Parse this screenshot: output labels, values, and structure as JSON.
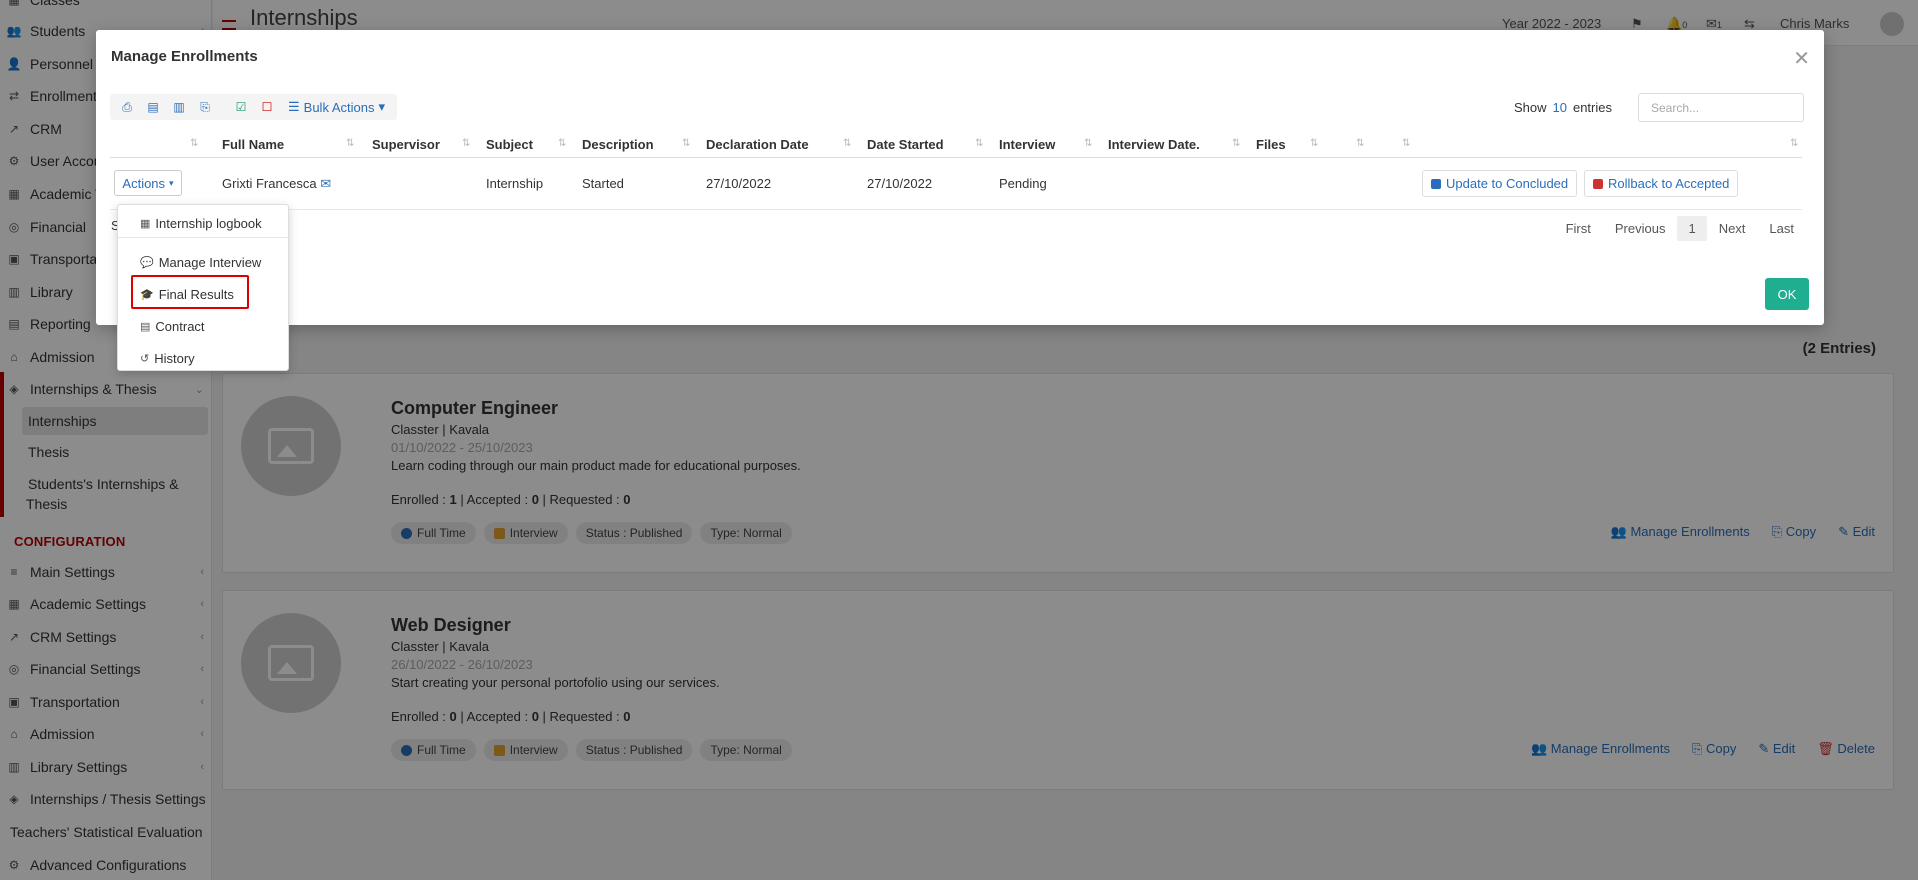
{
  "app": {
    "page_title": "Internships",
    "year_selector": "Year 2022 - 2023",
    "user_name": "Chris Marks",
    "notifications_count": "0",
    "messages_count": "1"
  },
  "sidebar": {
    "items": [
      {
        "label": "Classes",
        "icon": "grid-icon"
      },
      {
        "label": "Students",
        "icon": "users-icon"
      },
      {
        "label": "Personnel",
        "icon": "user-icon"
      },
      {
        "label": "Enrollment",
        "icon": "swap-icon"
      },
      {
        "label": "CRM",
        "icon": "chart-icon"
      },
      {
        "label": "User Accou",
        "icon": "user-cog-icon"
      },
      {
        "label": "Academic T",
        "icon": "grid-icon"
      },
      {
        "label": "Financial",
        "icon": "coins-icon"
      },
      {
        "label": "Transporta",
        "icon": "bus-icon"
      },
      {
        "label": "Library",
        "icon": "books-icon"
      },
      {
        "label": "Reporting",
        "icon": "file-icon"
      },
      {
        "label": "Admission",
        "icon": "bank-icon"
      },
      {
        "label": "Internships & Thesis",
        "icon": "cube-icon"
      }
    ],
    "sub_items": [
      "Internships",
      "Thesis",
      "Students's Internships &",
      "Thesis"
    ],
    "config_header": "CONFIGURATION",
    "config_items": [
      {
        "label": "Main Settings",
        "icon": "sliders-icon"
      },
      {
        "label": "Academic Settings",
        "icon": "grid-icon"
      },
      {
        "label": "CRM Settings",
        "icon": "chart-icon"
      },
      {
        "label": "Financial Settings",
        "icon": "coins-icon"
      },
      {
        "label": "Transportation",
        "icon": "bus-icon"
      },
      {
        "label": "Admission",
        "icon": "bank-icon"
      },
      {
        "label": "Library Settings",
        "icon": "books-icon"
      },
      {
        "label": "Internships / Thesis Settings",
        "icon": "cube-icon"
      },
      {
        "label": "Teachers' Statistical Evaluation",
        "icon": ""
      },
      {
        "label": "Advanced Configurations",
        "icon": "gear-icon"
      }
    ]
  },
  "content": {
    "entries_count": "(2 Entries)",
    "cards": [
      {
        "title": "Computer Engineer",
        "subtitle": "Classter | Kavala",
        "dates": "01/10/2022 - 25/10/2023",
        "description": "Learn coding through our main product made for educational purposes.",
        "counts_label_enrolled": "Enrolled : ",
        "enrolled": "1",
        "counts_label_accepted": " | Accepted : ",
        "accepted": "0",
        "counts_label_requested": " | Requested : ",
        "requested": "0",
        "tags": [
          "Full Time",
          "Interview",
          "Status : Published",
          "Type: Normal"
        ],
        "actions": [
          "Manage Enrollments",
          "Copy",
          "Edit"
        ]
      },
      {
        "title": "Web Designer",
        "subtitle": "Classter | Kavala",
        "dates": "26/10/2022 - 26/10/2023",
        "description": "Start creating your personal portofolio using our services.",
        "counts_label_enrolled": "Enrolled : ",
        "enrolled": "0",
        "counts_label_accepted": " | Accepted : ",
        "accepted": "0",
        "counts_label_requested": " | Requested : ",
        "requested": "0",
        "tags": [
          "Full Time",
          "Interview",
          "Status : Published",
          "Type: Normal"
        ],
        "actions": [
          "Manage Enrollments",
          "Copy",
          "Edit",
          "Delete"
        ]
      }
    ]
  },
  "modal": {
    "title": "Manage Enrollments",
    "bulk_actions": "Bulk Actions",
    "show_label": "Show",
    "show_value": "10",
    "entries_label": "entries",
    "search_placeholder": "Search...",
    "columns": [
      "Full Name",
      "Supervisor",
      "Subject",
      "Description",
      "Declaration Date",
      "Date Started",
      "Interview",
      "Interview Date.",
      "Files"
    ],
    "row": {
      "actions_label": "Actions",
      "full_name": "Grixti Francesca",
      "supervisor": "",
      "subject": "Internship",
      "description": "Started",
      "declaration_date": "27/10/2022",
      "date_started": "27/10/2022",
      "interview": "Pending",
      "update_button": "Update to Concluded",
      "rollback_button": "Rollback to Accepted"
    },
    "behind_text": "S",
    "pager": {
      "first": "First",
      "previous": "Previous",
      "current": "1",
      "next": "Next",
      "last": "Last"
    },
    "ok_label": "OK"
  },
  "dropdown": {
    "items": [
      "Internship logbook",
      "Manage Interview",
      "Final Results",
      "Contract",
      "History"
    ]
  }
}
